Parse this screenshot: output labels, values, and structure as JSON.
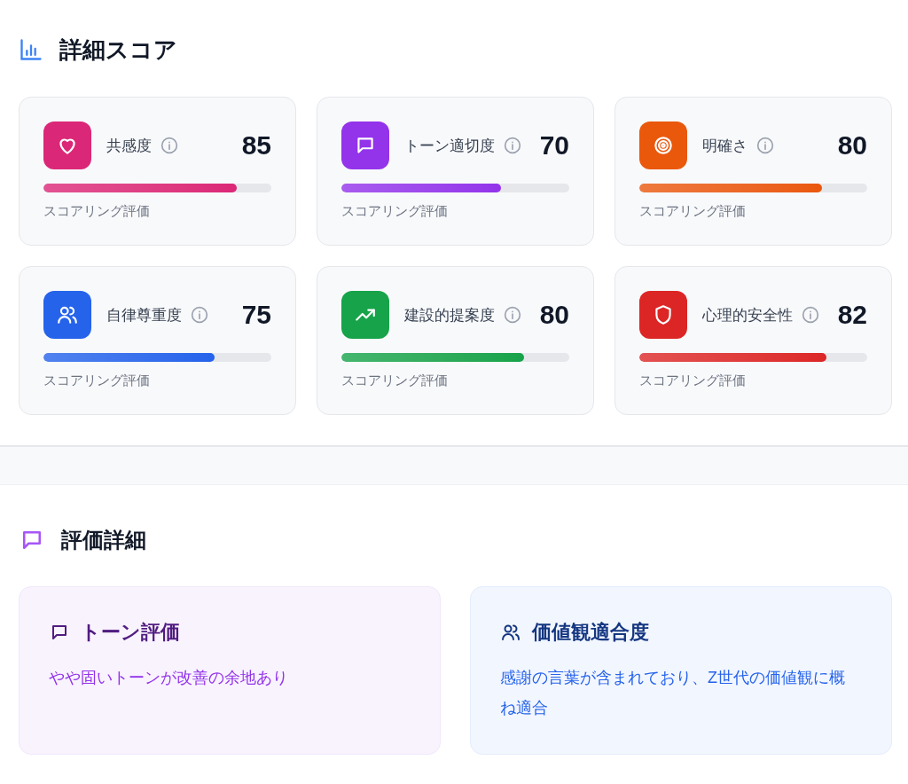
{
  "score_section": {
    "title": "詳細スコア",
    "cards": [
      {
        "label": "共感度",
        "score": "85",
        "level": 0.85,
        "caption": "スコアリング評価",
        "color": "#db2777"
      },
      {
        "label": "トーン適切度",
        "score": "70",
        "level": 0.7,
        "caption": "スコアリング評価",
        "color": "#9333ea"
      },
      {
        "label": "明確さ",
        "score": "80",
        "level": 0.8,
        "caption": "スコアリング評価",
        "color": "#ea580c"
      },
      {
        "label": "自律尊重度",
        "score": "75",
        "level": 0.75,
        "caption": "スコアリング評価",
        "color": "#2563eb"
      },
      {
        "label": "建設的提案度",
        "score": "80",
        "level": 0.8,
        "caption": "スコアリング評価",
        "color": "#16a34a"
      },
      {
        "label": "心理的安全性",
        "score": "82",
        "level": 0.82,
        "caption": "スコアリング評価",
        "color": "#dc2626"
      }
    ]
  },
  "detail_section": {
    "title": "評価詳細",
    "cards": [
      {
        "title": "トーン評価",
        "text": "やや固いトーンが改善の余地あり",
        "color": "#9333ea"
      },
      {
        "title": "価値観適合度",
        "text": "感謝の言葉が含まれており、Z世代の価値観に概ね適合",
        "color": "#2563eb"
      }
    ]
  }
}
